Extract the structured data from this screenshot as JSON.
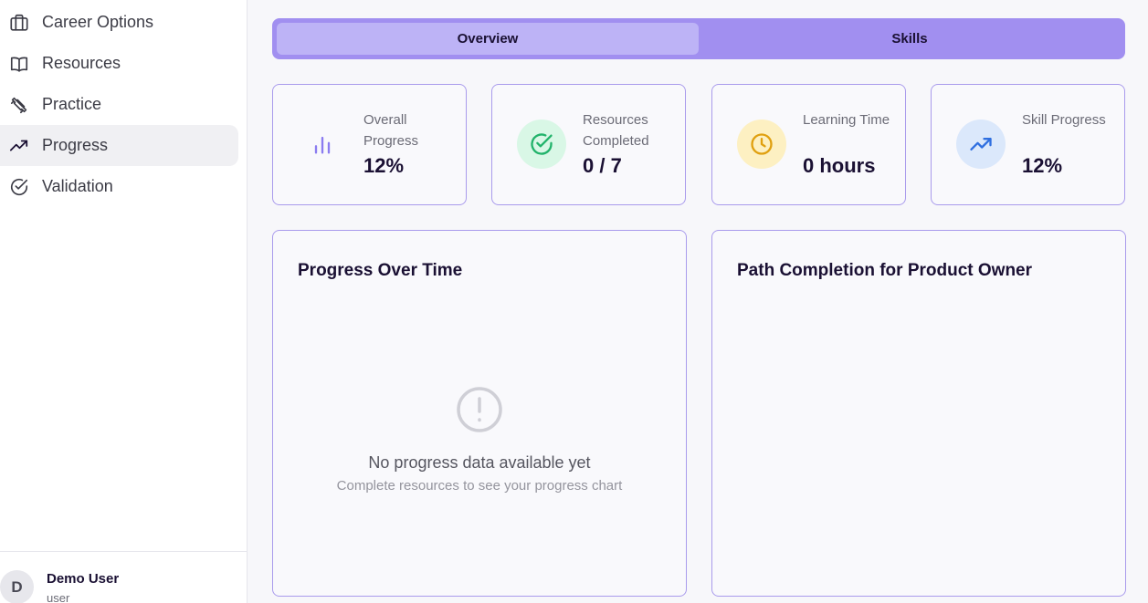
{
  "sidebar": {
    "items": [
      {
        "label": "Career Options",
        "icon": "briefcase-icon"
      },
      {
        "label": "Resources",
        "icon": "book-icon"
      },
      {
        "label": "Practice",
        "icon": "dumbbell-icon"
      },
      {
        "label": "Progress",
        "icon": "trending-up-icon",
        "active": true
      },
      {
        "label": "Validation",
        "icon": "check-circle-icon"
      }
    ],
    "user": {
      "initial": "D",
      "name": "Demo User",
      "role": "user"
    }
  },
  "tabs": [
    {
      "label": "Overview",
      "active": true
    },
    {
      "label": "Skills",
      "active": false
    }
  ],
  "stats": [
    {
      "label": "Overall Progress",
      "value": "12%",
      "icon": "bar-chart-icon",
      "icon_color": "#8b7cf0",
      "icon_bg": "transparent"
    },
    {
      "label": "Resources Completed",
      "value": "0 / 7",
      "icon": "check-circle-icon",
      "icon_color": "#22b36b",
      "icon_bg": "#d9f7e6"
    },
    {
      "label": "Learning Time",
      "value": "0 hours",
      "icon": "clock-icon",
      "icon_color": "#e0a010",
      "icon_bg": "#fdf0c2"
    },
    {
      "label": "Skill Progress",
      "value": "12%",
      "icon": "trending-up-icon",
      "icon_color": "#2f6fe0",
      "icon_bg": "#dbe8fb"
    }
  ],
  "panels": {
    "progress_over_time": {
      "title": "Progress Over Time",
      "empty_title": "No progress data available yet",
      "empty_subtitle": "Complete resources to see your progress chart"
    },
    "path_completion": {
      "title": "Path Completion for Product Owner"
    }
  },
  "colors": {
    "accent": "#a18ff0",
    "accent_active": "#bdb3f6",
    "card_border": "#a99bec",
    "text_dark": "#1a1033"
  }
}
